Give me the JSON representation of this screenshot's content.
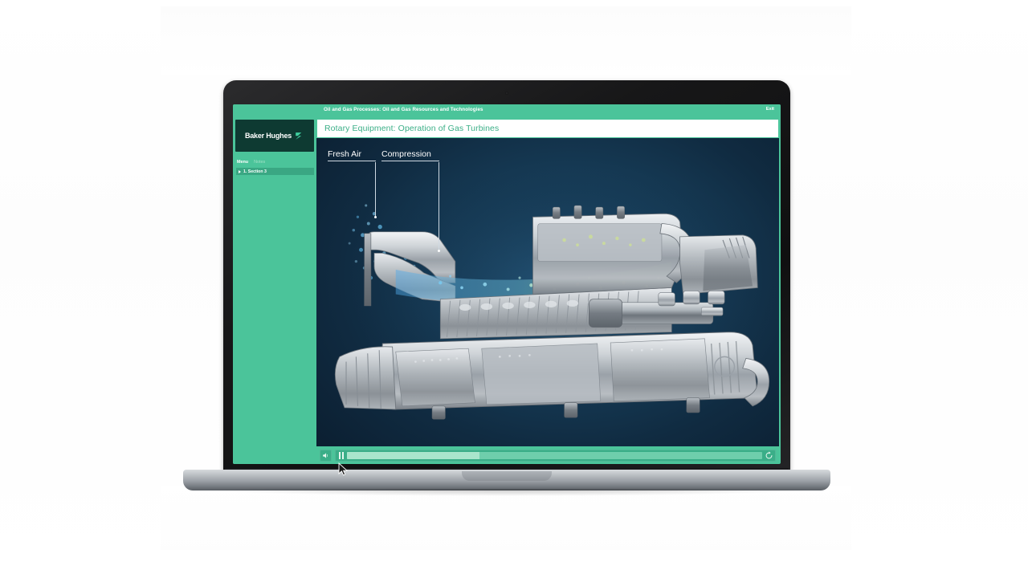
{
  "app": {
    "course_title": "Oil and Gas Processes: Oil and Gas Resources and Technologies",
    "exit_label": "Exit",
    "page_title": "Rotary Equipment: Operation of Gas Turbines"
  },
  "brand": {
    "logo_text": "Baker Hughes",
    "logo_mark": "chevron-mark",
    "logo_bg": "#0E3A32",
    "accent_green": "#4BC49A",
    "title_green": "#3BAF87"
  },
  "sidebar": {
    "tabs": [
      {
        "label": "Menu",
        "active": true
      },
      {
        "label": "Notes",
        "active": false
      }
    ],
    "nav_items": [
      {
        "label": "1. Section 3",
        "selected": true
      }
    ]
  },
  "stage": {
    "background": "#102b41",
    "illustration": "gas-turbine-cutaway",
    "callouts": [
      {
        "label": "Fresh Air"
      },
      {
        "label": "Compression"
      }
    ]
  },
  "player": {
    "volume_icon": "speaker-icon",
    "pause_icon": "pause-icon",
    "replay_icon": "replay-icon",
    "progress_percent": 32,
    "track_color": "#6FCEAC",
    "fill_color": "#A9E5CC"
  },
  "device": {
    "type": "laptop-mockup",
    "webcam": "webcam-dot"
  }
}
